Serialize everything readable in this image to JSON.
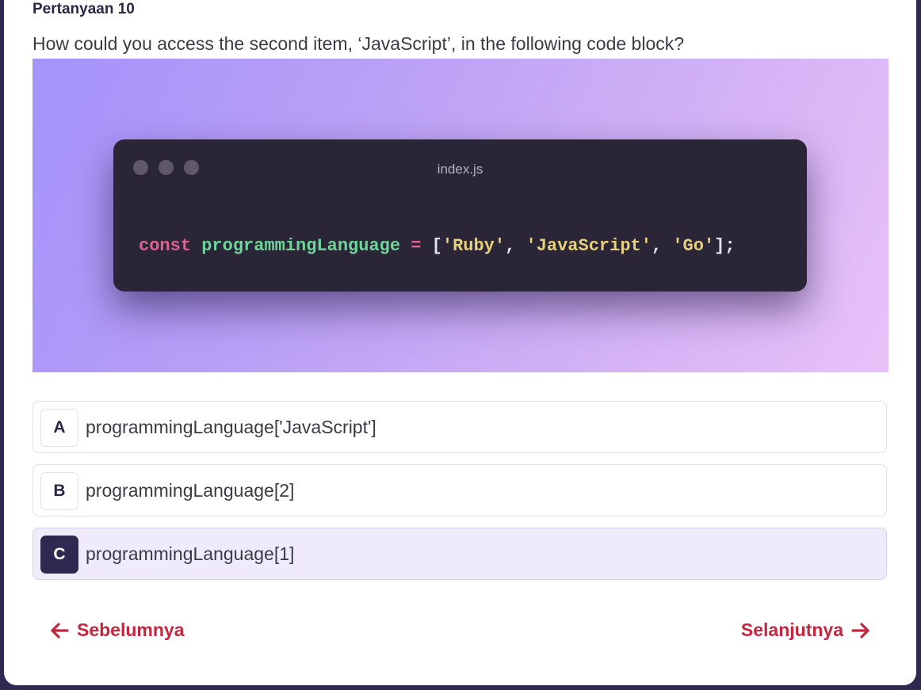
{
  "question": {
    "number_label": "Pertanyaan 10",
    "text": "How could you access the second item, ‘JavaScript’, in the following code block?"
  },
  "code_image": {
    "file_name": "index.js",
    "tokens": {
      "keyword": "const",
      "identifier": "programmingLanguage",
      "operator": "=",
      "open_bracket": "[",
      "item1": "'Ruby'",
      "sep1": ",",
      "item2": "'JavaScript'",
      "sep2": ",",
      "item3": "'Go'",
      "close": "];"
    },
    "colors": {
      "keyword": "#e0638f",
      "identifier": "#6fd69a",
      "string": "#e6d17a"
    }
  },
  "options": [
    {
      "letter": "A",
      "text": "programmingLanguage['JavaScript']",
      "selected": false
    },
    {
      "letter": "B",
      "text": "programmingLanguage[2]",
      "selected": false
    },
    {
      "letter": "C",
      "text": "programmingLanguage[1]",
      "selected": true
    }
  ],
  "navigation": {
    "prev_label": "Sebelumnya",
    "next_label": "Selanjutnya",
    "accent_color": "#c4263f"
  },
  "icons": {
    "prev": "arrow-left-icon",
    "next": "arrow-right-icon"
  }
}
